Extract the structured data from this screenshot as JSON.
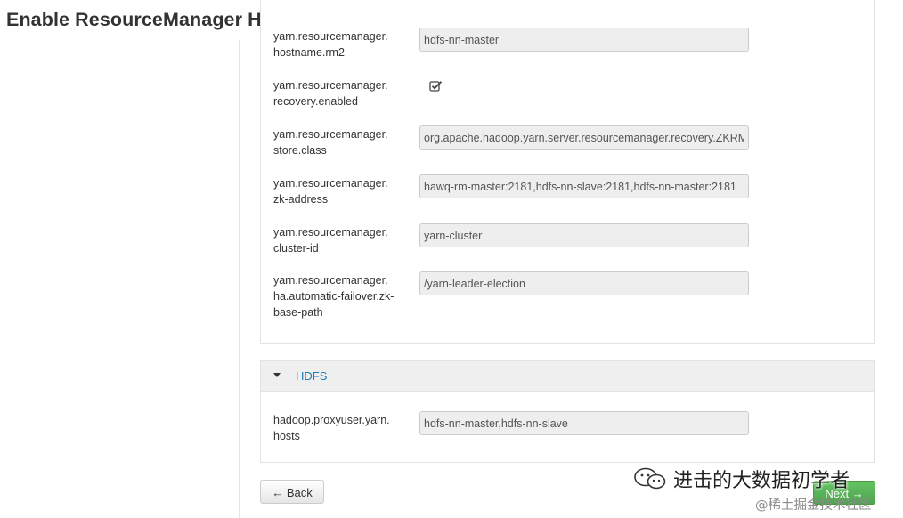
{
  "header": {
    "title": "Enable ResourceManager HA Wizard"
  },
  "yarn_properties": [
    {
      "name": "yarn.resourcemanager.\nhostname.rm2",
      "value": "hdfs-nn-master",
      "type": "text"
    },
    {
      "name": "yarn.resourcemanager.\nrecovery.enabled",
      "type": "checkbox",
      "checked": true
    },
    {
      "name": "yarn.resourcemanager.\nstore.class",
      "value": "org.apache.hadoop.yarn.server.resourcemanager.recovery.ZKRMStateStore",
      "type": "text"
    },
    {
      "name": "yarn.resourcemanager.\nzk-address",
      "value": "hawq-rm-master:2181,hdfs-nn-slave:2181,hdfs-nn-master:2181",
      "type": "text"
    },
    {
      "name": "yarn.resourcemanager.\ncluster-id",
      "value": "yarn-cluster",
      "type": "text"
    },
    {
      "name": "yarn.resourcemanager.\nha.automatic-failover.zk-\nbase-path",
      "value": "/yarn-leader-election",
      "type": "text"
    }
  ],
  "hdfs_section": {
    "title": "HDFS",
    "properties": [
      {
        "name": "hadoop.proxyuser.yarn.\nhosts",
        "value": "hdfs-nn-master,hdfs-nn-slave",
        "type": "text"
      }
    ]
  },
  "buttons": {
    "back": "← Back",
    "next": "Next →"
  },
  "watermarks": {
    "primary": "进击的大数据初学者",
    "secondary": "@稀土掘金技术社区"
  },
  "colors": {
    "link": "#1f79b8",
    "next_button": "#5bb75b"
  }
}
